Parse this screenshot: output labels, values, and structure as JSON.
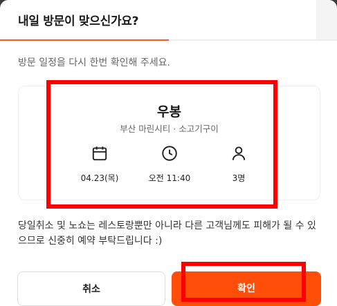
{
  "modal": {
    "title": "내일 방문이 맞으신가요?",
    "progress_fraction": 0.5
  },
  "subtitle": "방문 일정을 다시 한번 확인해 주세요.",
  "card": {
    "restaurant_name": "우봉",
    "location": "부산 마린시티 · 소고기구이",
    "date": "04.23(목)",
    "time": "오전 11:40",
    "party_size": "3명",
    "icons": [
      "calendar-icon",
      "clock-icon",
      "person-icon"
    ]
  },
  "notice": "당일취소 및 노쇼는 레스토랑뿐만 아니라 다른 고객님께도 피해가 될 수 있으므로 신중히 예약 부탁드립니다 :)",
  "buttons": {
    "cancel_label": "취소",
    "confirm_label": "확인"
  },
  "colors": {
    "accent": "#ff4d0a",
    "highlight": "#ff0000"
  }
}
